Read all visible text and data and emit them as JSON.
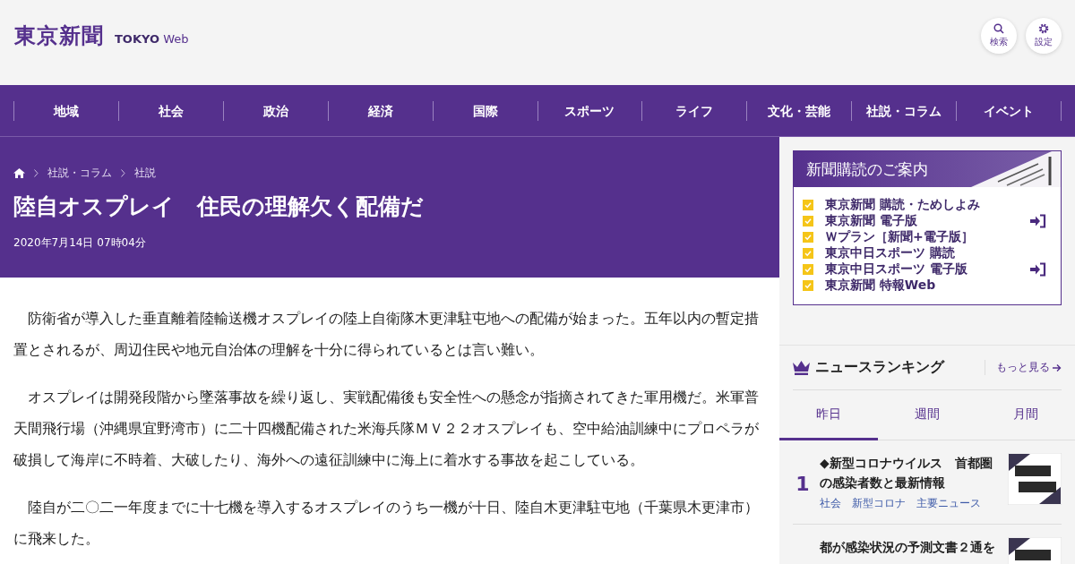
{
  "header": {
    "logo": "東京新聞",
    "logo_sub_bold": "TOKYO",
    "logo_sub": "Web",
    "buttons": [
      {
        "kind": "search",
        "label": "検索"
      },
      {
        "kind": "settings",
        "label": "設定"
      }
    ]
  },
  "nav": [
    "地域",
    "社会",
    "政治",
    "経済",
    "国際",
    "スポーツ",
    "ライフ",
    "文化・芸能",
    "社説・コラム",
    "イベント"
  ],
  "breadcrumb": [
    "社説・コラム",
    "社説"
  ],
  "article": {
    "title": "陸自オスプレイ　住民の理解欠く配備だ",
    "date": "2020年7月14日 07時04分",
    "paragraphs": [
      "防衛省が導入した垂直離着陸輸送機オスプレイの陸上自衛隊木更津駐屯地への配備が始まった。五年以内の暫定措置とされるが、周辺住民や地元自治体の理解を十分に得られているとは言い難い。",
      "オスプレイは開発段階から墜落事故を繰り返し、実戦配備後も安全性への懸念が指摘されてきた軍用機だ。米軍普天間飛行場（沖縄県宜野湾市）に二十四機配備された米海兵隊ＭＶ２２オスプレイも、空中給油訓練中にプロペラが破損して海岸に不時着、大破したり、海外への遠征訓練中に海上に着水する事故を起こしている。",
      "陸自が二〇二一年度までに十七機を導入するオスプレイのうち一機が十日、陸自木更津駐屯地（千葉県木更津市）に飛来した。"
    ]
  },
  "subscription": {
    "title": "新聞購読のご案内",
    "items": [
      {
        "label": "東京新聞 購読・ためしよみ",
        "login": false
      },
      {
        "label": "東京新聞 電子版",
        "login": true
      },
      {
        "label": "Ｗプラン［新聞+電子版］",
        "login": false
      },
      {
        "label": "東京中日スポーツ 購読",
        "login": false
      },
      {
        "label": "東京中日スポーツ 電子版",
        "login": true
      },
      {
        "label": "東京新聞 特報Web",
        "login": false
      }
    ]
  },
  "ranking": {
    "title": "ニュースランキング",
    "more": "もっと見る",
    "tabs": [
      {
        "label": "昨日",
        "selected": true
      },
      {
        "label": "週間",
        "selected": false
      },
      {
        "label": "月間",
        "selected": false
      }
    ],
    "items": [
      {
        "rank": "1",
        "title": "◆新型コロナウイルス　首都圏の感染者数と最新情報",
        "tags": [
          "社会",
          "新型コロナ",
          "主要ニュース"
        ]
      },
      {
        "title": "都が感染状況の予測文書２通を"
      }
    ]
  }
}
